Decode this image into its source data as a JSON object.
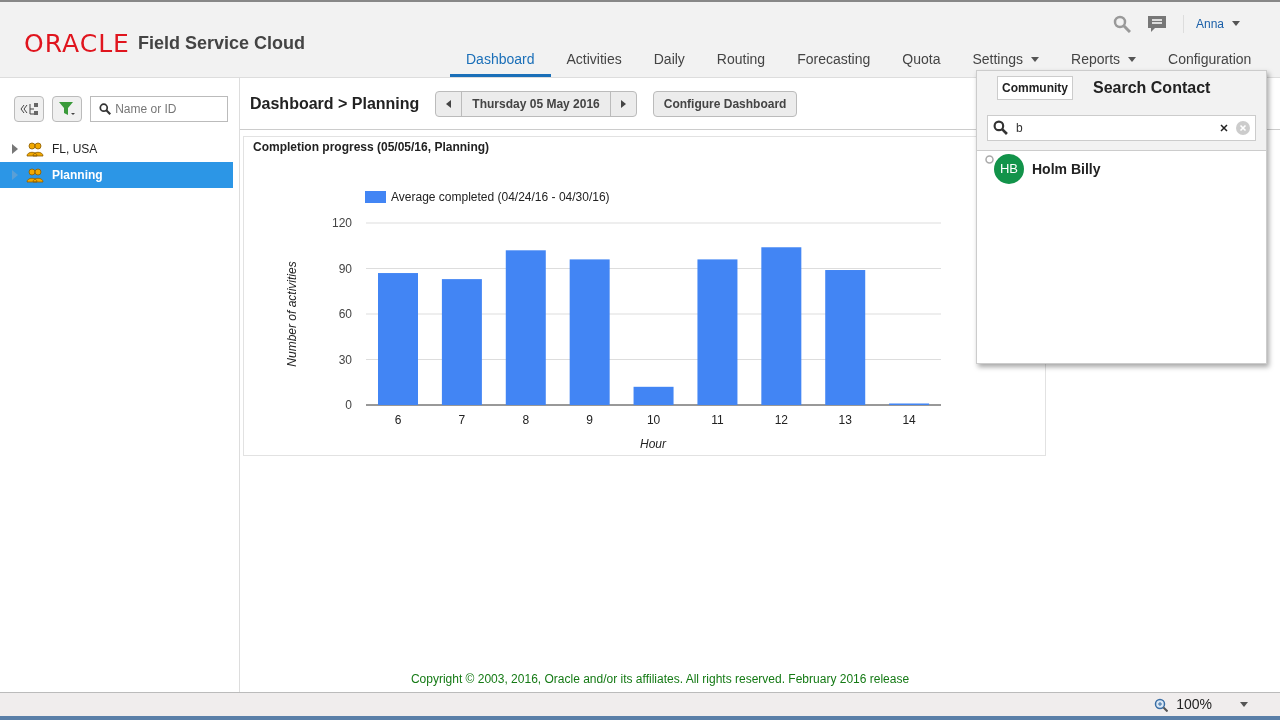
{
  "header": {
    "brand": "ORACLE",
    "product": "Field Service Cloud",
    "user": "Anna",
    "nav": [
      {
        "label": "Dashboard",
        "selected": true,
        "menu": false
      },
      {
        "label": "Activities",
        "selected": false,
        "menu": false
      },
      {
        "label": "Daily",
        "selected": false,
        "menu": false
      },
      {
        "label": "Routing",
        "selected": false,
        "menu": false
      },
      {
        "label": "Forecasting",
        "selected": false,
        "menu": false
      },
      {
        "label": "Quota",
        "selected": false,
        "menu": false
      },
      {
        "label": "Settings",
        "selected": false,
        "menu": true
      },
      {
        "label": "Reports",
        "selected": false,
        "menu": true
      },
      {
        "label": "Configuration",
        "selected": false,
        "menu": false
      }
    ]
  },
  "sidebar": {
    "search": {
      "placeholder": "Name or ID"
    },
    "tree": [
      {
        "label": "FL, USA",
        "selected": false
      },
      {
        "label": "Planning",
        "selected": true
      }
    ]
  },
  "toolbar": {
    "breadcrumb": "Dashboard > Planning",
    "date": "Thursday 05 May 2016",
    "configure": "Configure Dashboard"
  },
  "widget": {
    "title": "Completion progress (05/05/16, Planning)",
    "chart_data": {
      "type": "bar",
      "xlabel": "Hour",
      "ylabel": "Number of activities",
      "categories": [
        "6",
        "7",
        "8",
        "9",
        "10",
        "11",
        "12",
        "13",
        "14"
      ],
      "series": [
        {
          "name": "Average completed (04/24/16 - 04/30/16)",
          "color": "#4285f4",
          "values": [
            87,
            83,
            102,
            96,
            12,
            96,
            104,
            89,
            1
          ]
        }
      ],
      "ylim": [
        0,
        120
      ],
      "grid": true,
      "yticks": [
        0,
        30,
        60,
        90,
        120
      ]
    }
  },
  "popup": {
    "tab": "Community",
    "title": "Search Contact",
    "search": {
      "value": "b"
    },
    "contacts": [
      {
        "initials": "HB",
        "name": "Holm Billy",
        "color": "#12934a"
      }
    ]
  },
  "footer": {
    "copyright": "Copyright © 2003, 2016, Oracle and/or its affiliates. All rights reserved. February 2016 release"
  },
  "status_bar": {
    "zoom": "100%"
  }
}
